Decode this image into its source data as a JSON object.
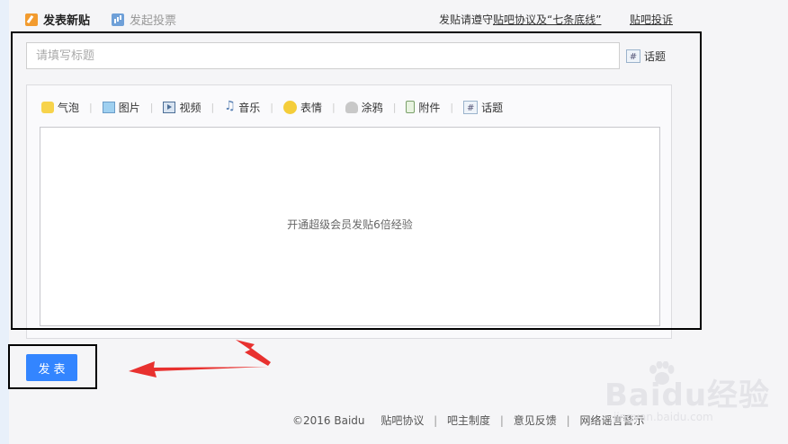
{
  "header": {
    "tab_post": "发表新贴",
    "tab_vote": "发起投票",
    "rules_prefix": "发贴请遵守",
    "rules_link": "贴吧协议及“七条底线”",
    "report_link": "贴吧投诉"
  },
  "title_input": {
    "placeholder": "请填写标题",
    "value": ""
  },
  "topic_button": {
    "label": "话题",
    "icon": "hash-icon"
  },
  "toolbar": {
    "items": [
      {
        "label": "气泡",
        "icon": "bubble-icon"
      },
      {
        "label": "图片",
        "icon": "image-icon"
      },
      {
        "label": "视频",
        "icon": "video-icon"
      },
      {
        "label": "音乐",
        "icon": "music-icon"
      },
      {
        "label": "表情",
        "icon": "smiley-icon"
      },
      {
        "label": "涂鸦",
        "icon": "brush-icon"
      },
      {
        "label": "附件",
        "icon": "attachment-icon"
      },
      {
        "label": "话题",
        "icon": "hash-icon"
      }
    ],
    "topic_glyph": "#"
  },
  "editor": {
    "placeholder": "开通超级会员发贴6倍经验"
  },
  "submit_button": {
    "label": "发表"
  },
  "footer": {
    "copyright": "©2016 Baidu",
    "links": [
      "贴吧协议",
      "吧主制度",
      "意见反馈",
      "网络谣言警示"
    ]
  },
  "watermark": {
    "brand": "Baidu经验",
    "url": "jingyan.baidu.com"
  },
  "colors": {
    "primary_button": "#3385ff",
    "annotation_arrow": "#e8312f",
    "annotation_box": "#000000"
  }
}
